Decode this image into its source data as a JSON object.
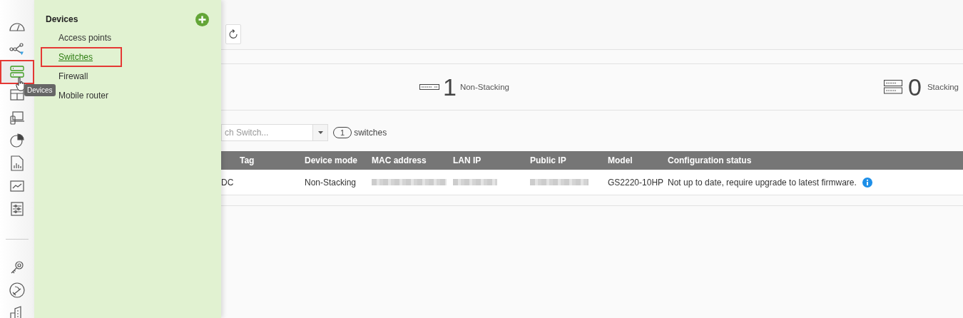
{
  "sidebar": {
    "items": [
      {
        "selected": false,
        "highlighted": false
      },
      {
        "selected": false,
        "highlighted": false
      },
      {
        "selected": true,
        "highlighted": true
      },
      {
        "selected": false,
        "highlighted": false
      },
      {
        "selected": false,
        "highlighted": false
      },
      {
        "selected": false,
        "highlighted": false
      },
      {
        "selected": false,
        "highlighted": false
      },
      {
        "selected": false,
        "highlighted": false
      },
      {
        "selected": false,
        "highlighted": false
      }
    ],
    "lower_items": [
      {
        "selected": false
      },
      {
        "selected": false
      },
      {
        "selected": false
      }
    ],
    "tooltip": "Devices"
  },
  "flyout": {
    "title": "Devices",
    "items": [
      {
        "label": "Access points",
        "selected": false,
        "highlighted": false
      },
      {
        "label": "Switches",
        "selected": true,
        "highlighted": true
      },
      {
        "label": "Firewall",
        "selected": false,
        "highlighted": false
      },
      {
        "label": "Mobile router",
        "selected": false,
        "highlighted": false
      }
    ]
  },
  "summary": [
    {
      "kind": "single",
      "count": "1",
      "label": "Non-Stacking"
    },
    {
      "kind": "stack",
      "count": "0",
      "label": "Stacking"
    }
  ],
  "search": {
    "placeholder": "ch Switch..."
  },
  "count": {
    "value": "1",
    "label": "switches"
  },
  "table": {
    "columns": [
      "Tag",
      "Device mode",
      "MAC address",
      "LAN IP",
      "Public IP",
      "Model",
      "Configuration status"
    ],
    "rows": [
      {
        "column_1": "DC",
        "device_mode": "Non-Stacking",
        "model": "GS2220-10HP",
        "configuration_status": "Not up to date, require upgrade to latest firmware.",
        "info": true
      }
    ]
  }
}
